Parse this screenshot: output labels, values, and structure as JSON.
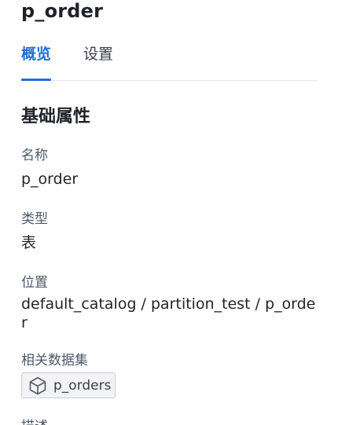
{
  "header": {
    "title": "p_order"
  },
  "tabs": [
    {
      "label": "概览",
      "active": true
    },
    {
      "label": "设置",
      "active": false
    }
  ],
  "section": {
    "title": "基础属性"
  },
  "fields": {
    "name": {
      "label": "名称",
      "value": "p_order"
    },
    "type": {
      "label": "类型",
      "value": "表"
    },
    "location": {
      "label": "位置",
      "value": "default_catalog / partition_test / p_order"
    },
    "related_dataset": {
      "label": "相关数据集",
      "tag_label": "p_orders",
      "tag_icon": "cube-icon"
    },
    "description": {
      "label": "描述"
    }
  },
  "colors": {
    "accent": "#1f6fd6",
    "text_primary": "#1f2329",
    "text_secondary": "#4e5969",
    "divider": "#e5e6eb",
    "tag_bg": "#f2f3f5",
    "tag_border": "#c9cdd4"
  }
}
